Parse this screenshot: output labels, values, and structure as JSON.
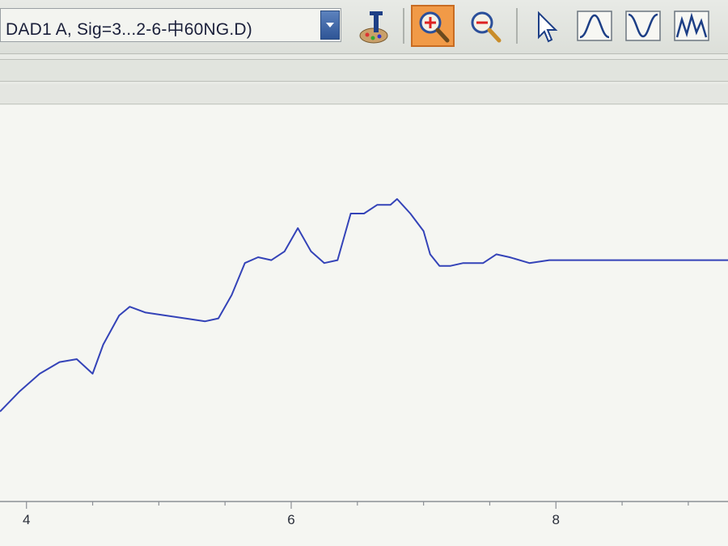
{
  "toolbar": {
    "signal_selector": {
      "value": "DAD1 A, Sig=3...2-6-中60NG.D)"
    },
    "tools": [
      {
        "name": "annotate-tool",
        "icon": "palette-text-icon",
        "active": false
      },
      {
        "name": "zoom-in-tool",
        "icon": "zoom-in-icon",
        "active": true
      },
      {
        "name": "zoom-out-tool",
        "icon": "zoom-out-icon",
        "active": false
      },
      {
        "name": "select-tool",
        "icon": "cursor-arrow-icon",
        "active": false
      },
      {
        "name": "peak-tool",
        "icon": "peak-icon",
        "active": false
      },
      {
        "name": "valley-tool",
        "icon": "valley-icon",
        "active": false
      },
      {
        "name": "multi-peak-tool",
        "icon": "multi-peak-icon",
        "active": false
      }
    ],
    "colors": {
      "active_tool": "#f19a47",
      "dropdown_button": "#3a62a5"
    }
  },
  "chart_data": {
    "type": "line",
    "title": "",
    "xlabel": "",
    "ylabel": "",
    "xlim": [
      3.8,
      9.3
    ],
    "ylim": [
      0,
      100
    ],
    "x_ticks": [
      4,
      6,
      8
    ],
    "x_tick_labels": [
      "4",
      "6",
      "8"
    ],
    "grid": false,
    "line_color": "#3443b8",
    "series": [
      {
        "x": [
          3.8,
          3.95,
          4.1,
          4.25,
          4.38,
          4.5,
          4.58,
          4.7,
          4.78,
          4.9,
          5.05,
          5.2,
          5.35,
          5.45,
          5.55,
          5.65,
          5.75,
          5.85,
          5.95,
          6.05,
          6.15,
          6.25,
          6.35,
          6.45,
          6.55,
          6.65,
          6.75,
          6.8,
          6.9,
          7.0,
          7.05,
          7.12,
          7.2,
          7.3,
          7.35,
          7.45,
          7.55,
          7.65,
          7.8,
          7.95,
          8.0,
          8.1,
          8.2,
          8.3,
          8.4,
          8.5,
          8.6,
          8.8,
          9.0,
          9.2,
          9.3
        ],
        "y": [
          17,
          24,
          30,
          34,
          35,
          30,
          40,
          50,
          53,
          51,
          50,
          49,
          48,
          49,
          57,
          68,
          70,
          69,
          72,
          80,
          72,
          68,
          69,
          85,
          85,
          88,
          88,
          90,
          85,
          79,
          71,
          67,
          67,
          68,
          68,
          68,
          71,
          70,
          68,
          69,
          69,
          69,
          69,
          69,
          69,
          69,
          69,
          69,
          69,
          69,
          69
        ]
      }
    ]
  }
}
